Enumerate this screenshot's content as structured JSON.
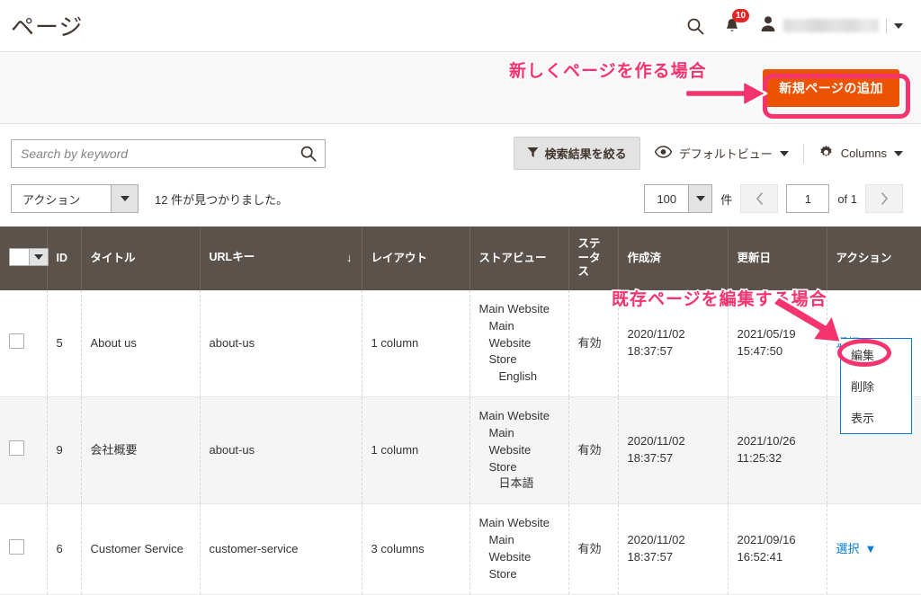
{
  "header": {
    "title": "ページ",
    "search_icon": "search-icon",
    "notifications_icon": "bell-icon",
    "notifications_count": "10",
    "user_icon": "user-icon",
    "user_menu_caret": "chevron-down-icon"
  },
  "page_actions": {
    "add_new_label": "新規ページの追加"
  },
  "toolbar": {
    "search_placeholder": "Search by keyword",
    "search_value": "",
    "search_icon": "search-icon",
    "filter_label": "検索結果を絞る",
    "filter_icon": "funnel-icon",
    "view_label": "デフォルトビュー",
    "view_icon": "eye-icon",
    "columns_label": "Columns",
    "columns_icon": "gear-icon",
    "action_select_label": "アクション",
    "found_text": "12 件が見つかりました。",
    "per_page_value": "100",
    "per_page_unit": "件",
    "prev_icon": "chevron-left-icon",
    "next_icon": "chevron-right-icon",
    "page_value": "1",
    "page_of": "of 1"
  },
  "grid": {
    "columns": [
      {
        "key": "checkbox",
        "label": ""
      },
      {
        "key": "id",
        "label": "ID"
      },
      {
        "key": "title",
        "label": "タイトル"
      },
      {
        "key": "url_key",
        "label": "URLキー",
        "sorted": "↓"
      },
      {
        "key": "layout",
        "label": "レイアウト"
      },
      {
        "key": "store_view",
        "label": "ストアビュー"
      },
      {
        "key": "status",
        "label": "ステータス"
      },
      {
        "key": "created",
        "label": "作成済"
      },
      {
        "key": "updated",
        "label": "更新日"
      },
      {
        "key": "action",
        "label": "アクション"
      }
    ],
    "rows": [
      {
        "id": "5",
        "title": "About us",
        "url_key": "about-us",
        "layout": "1 column",
        "store_l1": "Main Website",
        "store_l2": "Main Website Store",
        "store_l3": "English",
        "status": "有効",
        "created_date": "2020/11/02",
        "created_time": "18:37:57",
        "updated_date": "2021/05/19",
        "updated_time": "15:47:50",
        "action_label": "選択",
        "action_caret": "▲"
      },
      {
        "id": "9",
        "title": "会社概要",
        "url_key": "about-us",
        "layout": "1 column",
        "store_l1": "Main Website",
        "store_l2": "Main Website Store",
        "store_l3": "日本語",
        "status": "有効",
        "created_date": "2020/11/02",
        "created_time": "18:37:57",
        "updated_date": "2021/10/26",
        "updated_time": "11:25:32",
        "action_label": "",
        "action_caret": ""
      },
      {
        "id": "6",
        "title": "Customer Service",
        "url_key": "customer-service",
        "layout": "3 columns",
        "store_l1": "Main Website",
        "store_l2": "Main Website Store",
        "store_l3": "",
        "status": "有効",
        "created_date": "2020/11/02",
        "created_time": "18:37:57",
        "updated_date": "2021/09/16",
        "updated_time": "16:52:41",
        "action_label": "選択",
        "action_caret": "▼"
      }
    ]
  },
  "action_menu": {
    "edit": "編集",
    "delete": "削除",
    "view": "表示"
  },
  "annotations": {
    "new_page_note": "新しくページを作る場合",
    "edit_page_note": "既存ページを編集する場合",
    "accent_color": "#f5336f"
  }
}
